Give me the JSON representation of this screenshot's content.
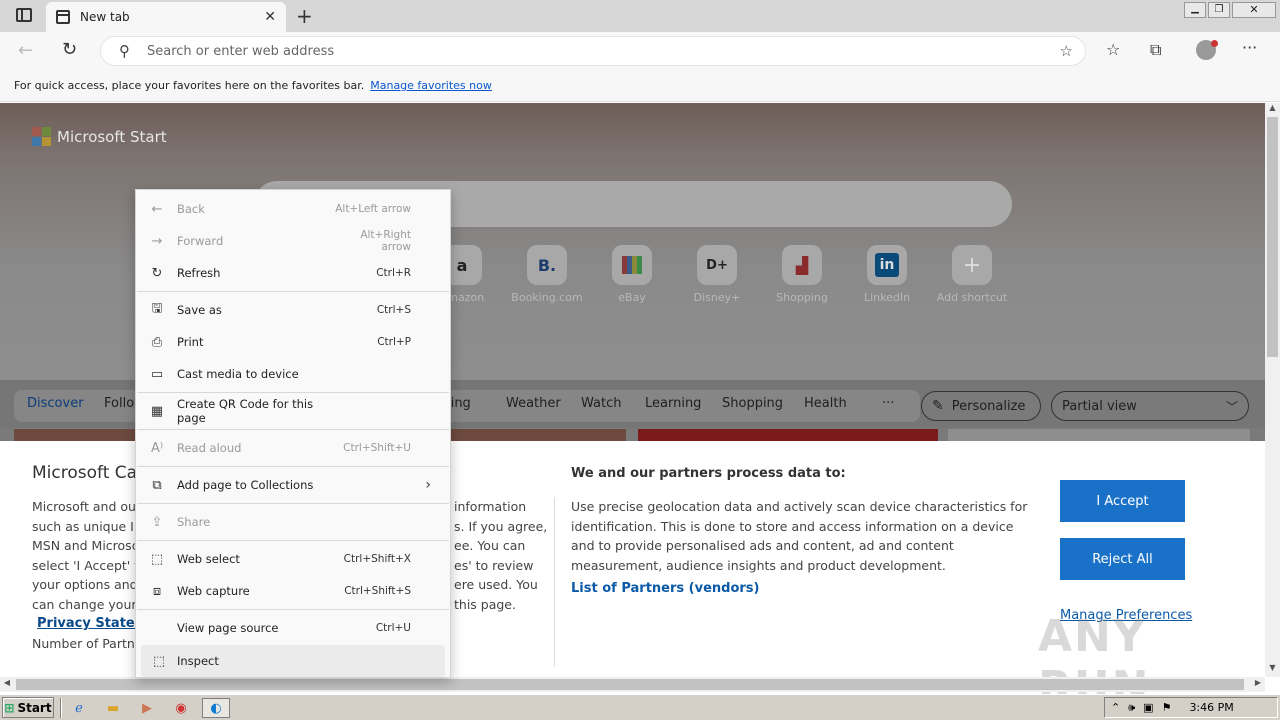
{
  "browser": {
    "tab_title": "New tab",
    "address_placeholder": "Search or enter web address",
    "favbar_text": "For quick access, place your favorites here on the favorites bar.",
    "favbar_link": "Manage favorites now"
  },
  "page": {
    "logo_text": "Microsoft Start",
    "shortcuts": [
      {
        "label": "Amazon",
        "icon": "a"
      },
      {
        "label": "Booking.com",
        "icon": "B."
      },
      {
        "label": "eBay",
        "icon": "bag"
      },
      {
        "label": "Disney+",
        "icon": "D+"
      },
      {
        "label": "Shopping",
        "icon": "bag"
      },
      {
        "label": "LinkedIn",
        "icon": "in"
      },
      {
        "label": "Add shortcut",
        "icon": "+"
      }
    ],
    "nav": {
      "discover": "Discover",
      "following": "Following",
      "gaming": "Gaming",
      "weather": "Weather",
      "watch": "Watch",
      "learning": "Learning",
      "shopping": "Shopping",
      "health": "Health",
      "more": "···",
      "personalize": "Personalize",
      "view": "Partial view"
    }
  },
  "consent": {
    "title": "Microsoft Ca",
    "left_lines": [
      "Microsoft and our",
      "such as unique ID",
      "MSN and Microsc",
      "select 'I Accept' to",
      "your options and",
      "can change your s"
    ],
    "mid_lines": [
      "information",
      "s. If you agree,",
      "ee. You can",
      "es' to review",
      "ere used.  You",
      " this page."
    ],
    "privacy_link": "Privacy Stateme",
    "partners_count": "Number of Partne",
    "right_title": "We and our partners process data to:",
    "right_body": "Use precise geolocation data and actively scan device characteristics for identification. This is done to store and access information on a device and to provide personalised ads and content, ad and content measurement, audience insights and product development.",
    "partners_link": "List of Partners (vendors)",
    "accept": "I Accept",
    "reject": "Reject All",
    "manage": "Manage Preferences"
  },
  "context_menu": {
    "back": {
      "label": "Back",
      "shortcut": "Alt+Left arrow"
    },
    "forward": {
      "label": "Forward",
      "shortcut": "Alt+Right arrow"
    },
    "refresh": {
      "label": "Refresh",
      "shortcut": "Ctrl+R"
    },
    "save_as": {
      "label": "Save as",
      "shortcut": "Ctrl+S"
    },
    "print": {
      "label": "Print",
      "shortcut": "Ctrl+P"
    },
    "cast": {
      "label": "Cast media to device",
      "shortcut": ""
    },
    "qr": {
      "label": "Create QR Code for this page",
      "shortcut": ""
    },
    "read_aloud": {
      "label": "Read aloud",
      "shortcut": "Ctrl+Shift+U"
    },
    "collections": {
      "label": "Add page to Collections",
      "shortcut": ""
    },
    "share": {
      "label": "Share",
      "shortcut": ""
    },
    "web_select": {
      "label": "Web select",
      "shortcut": "Ctrl+Shift+X"
    },
    "web_capture": {
      "label": "Web capture",
      "shortcut": "Ctrl+Shift+S"
    },
    "view_source": {
      "label": "View page source",
      "shortcut": "Ctrl+U"
    },
    "inspect": {
      "label": "Inspect",
      "shortcut": ""
    }
  },
  "taskbar": {
    "start": "Start",
    "time": "3:46 PM"
  },
  "watermark": "ANY RUN",
  "colors": {
    "accent": "#1a72c8",
    "link": "#0b57d0",
    "overlay": "#7a7a7a"
  }
}
